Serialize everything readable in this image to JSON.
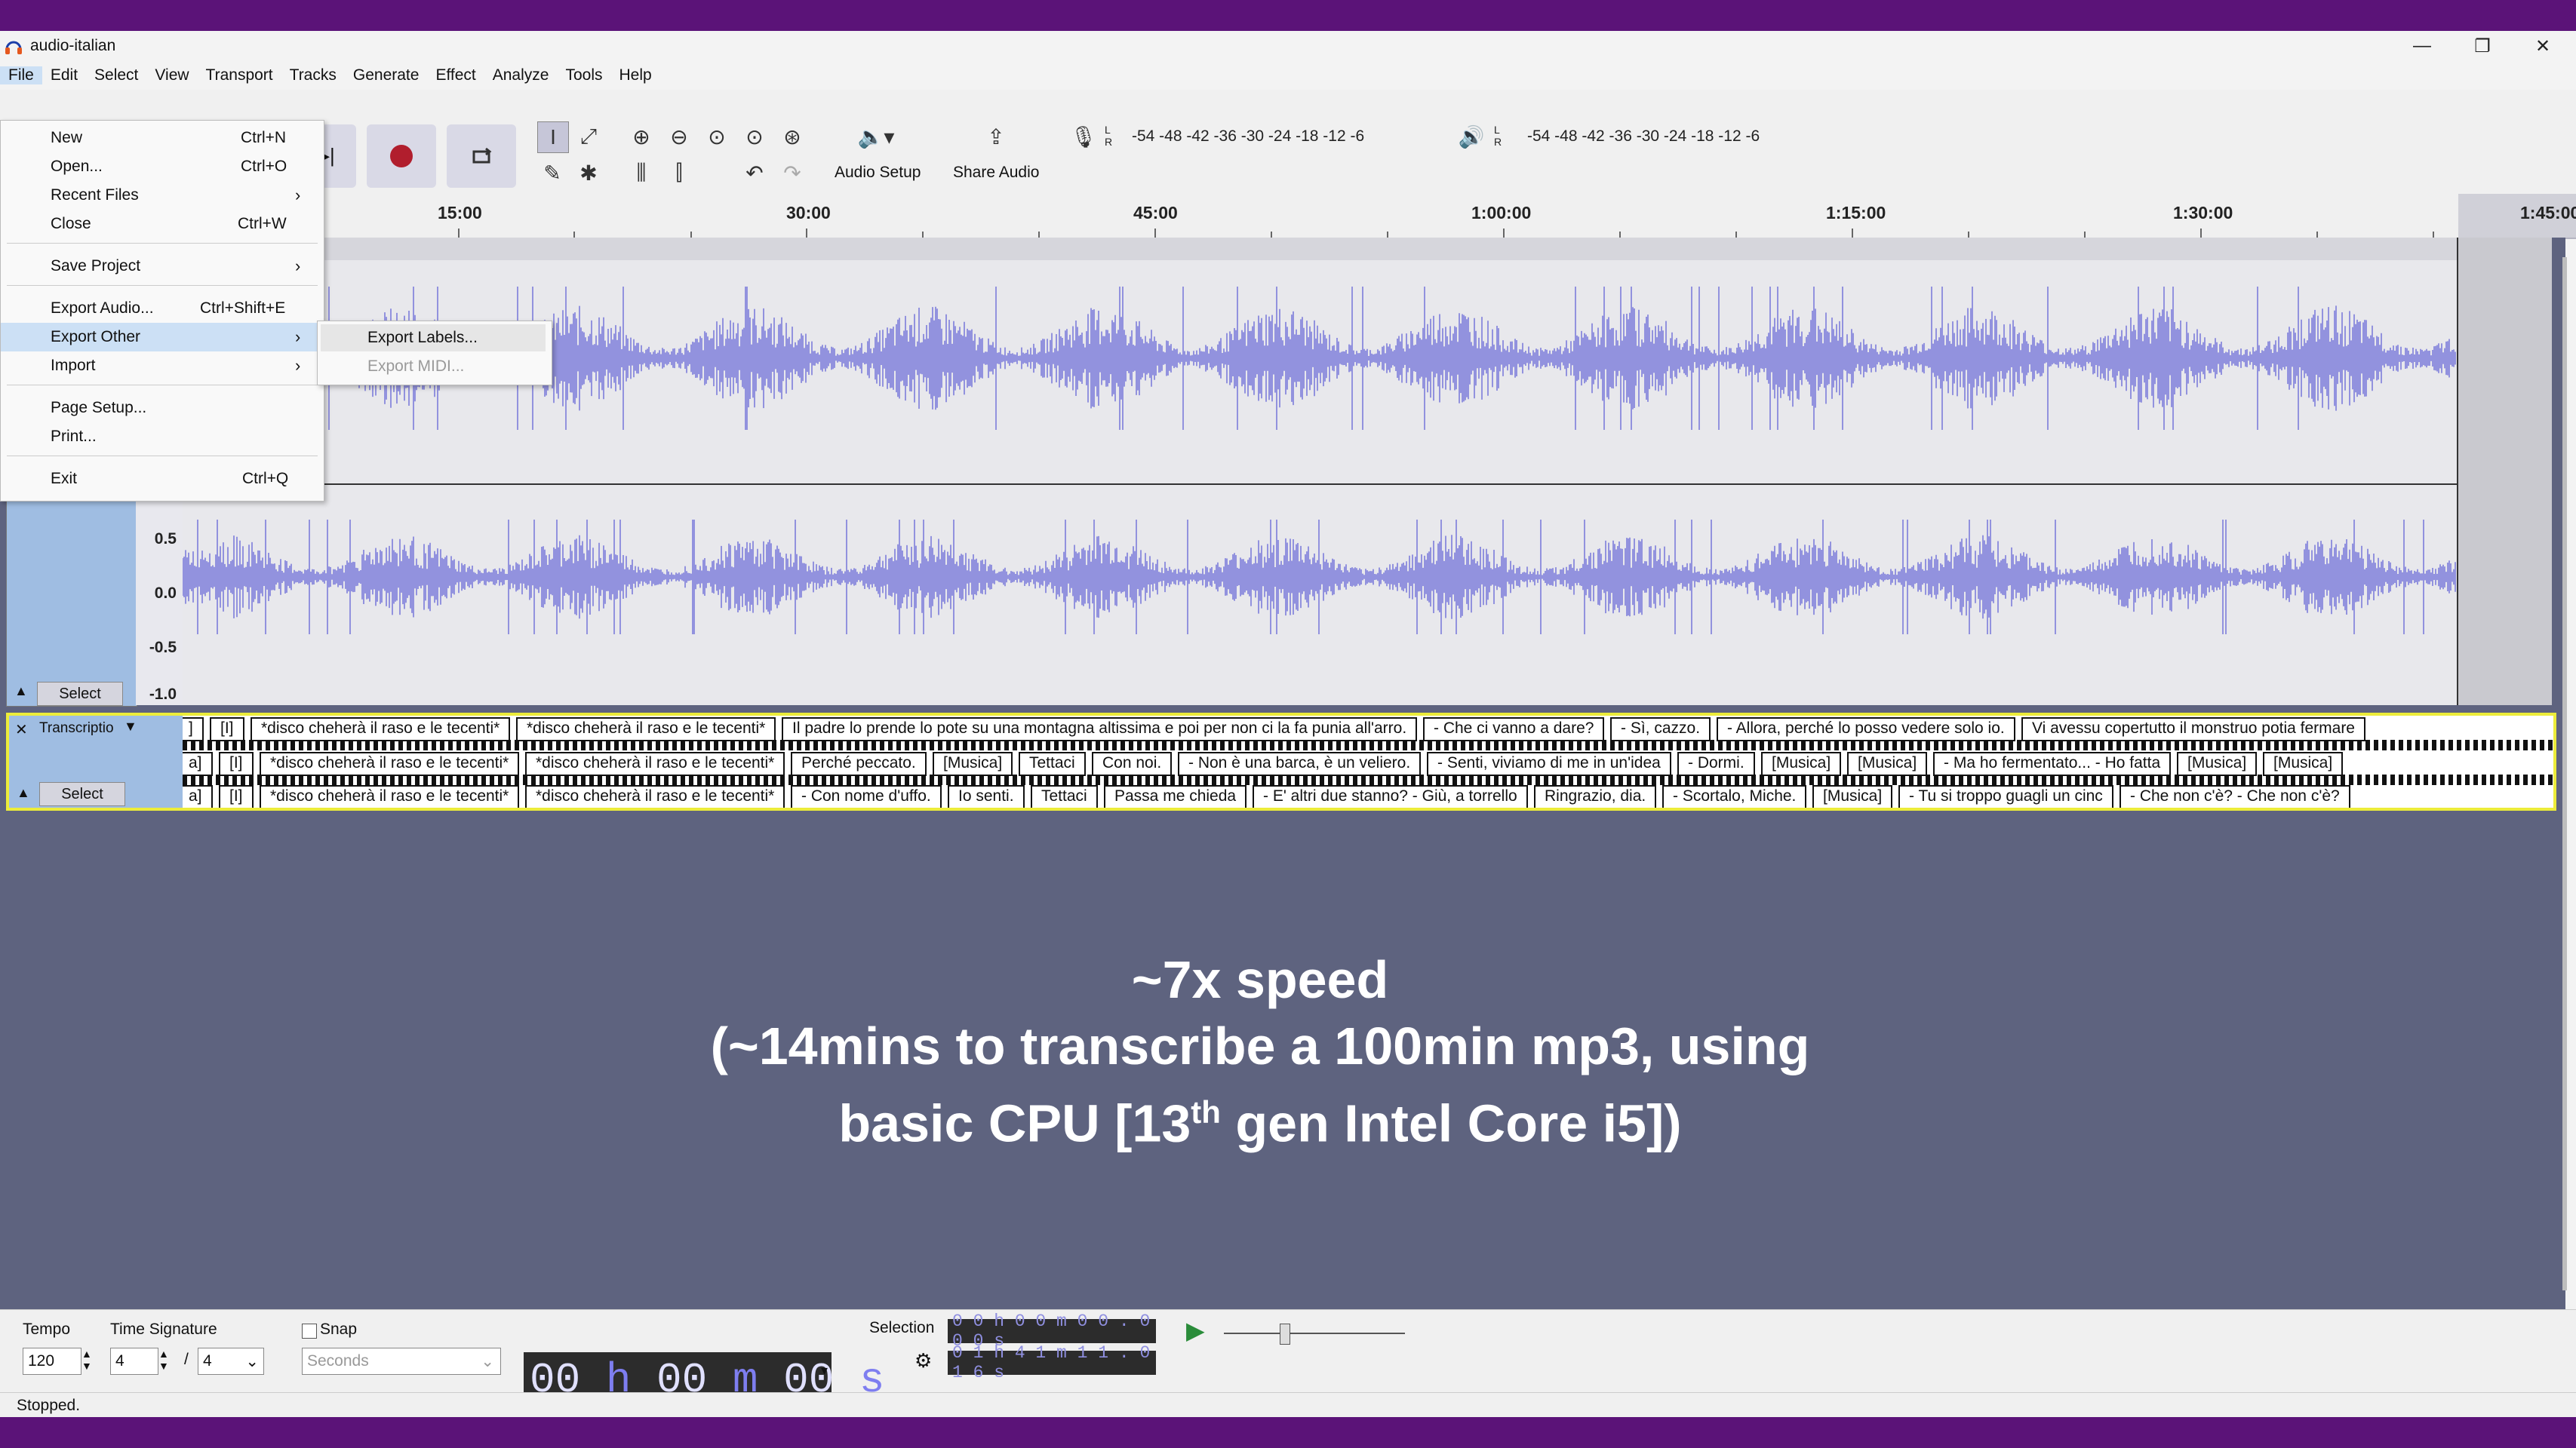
{
  "window": {
    "title": "audio-italian",
    "controls": [
      "—",
      "❐",
      "✕"
    ]
  },
  "menubar": [
    "File",
    "Edit",
    "Select",
    "View",
    "Transport",
    "Tracks",
    "Generate",
    "Effect",
    "Analyze",
    "Tools",
    "Help"
  ],
  "toolbar": {
    "audio_setup_label": "Audio Setup",
    "share_audio_label": "Share Audio",
    "record_meter_scale": "-54  -48  -42  -36  -30  -24  -18  -12  -6",
    "play_meter_scale": "-54  -48  -42  -36  -30  -24  -18  -12  -6",
    "meter_lr": "L\nR"
  },
  "ruler": {
    "labels": [
      "15:00",
      "30:00",
      "45:00",
      "1:00:00",
      "1:15:00",
      "1:30:00",
      "1:45:00"
    ]
  },
  "audio_track": {
    "scale": [
      "0.5",
      "0.0",
      "-0.5",
      "-1.0"
    ],
    "select_label": "Select",
    "wave_color": "#3d3dd0"
  },
  "label_track": {
    "name": "Transcriptio",
    "select_label": "Select",
    "row1": [
      "]",
      "[I]",
      "*disco cheherà il raso e le tecenti*",
      "*disco cheherà il raso e le tecenti*",
      "Il padre lo prende lo pote su una montagna altissima e poi per non ci la fa punia all'arro.",
      "- Che ci vanno a dare?",
      "- Sì, cazzo.",
      "- Allora, perché lo posso vedere solo io.",
      "Vi avessu copertutto il monstruo potia fermare"
    ],
    "row2": [
      "a]",
      "[I]",
      "*disco cheherà il raso e le tecenti*",
      "*disco cheherà il raso e le tecenti*",
      "Perché peccato.",
      "[Musica]",
      "Tettaci",
      "Con noi.",
      "- Non è una barca, è un veliero.",
      "- Senti, viviamo di me in un'idea",
      "- Dormi.",
      "[Musica]",
      "[Musica]",
      "- Ma ho fermentato... - Ho fatta",
      "[Musica]",
      "[Musica]"
    ],
    "row3": [
      "a]",
      "[I]",
      "*disco cheherà il raso e le tecenti*",
      "*disco cheherà il raso e le tecenti*",
      "- Con nome d'uffo.",
      "Io senti.",
      "Tettaci",
      "Passa me chieda",
      "- E' altri due stanno? - Giù, a torrello",
      "Ringrazio, dia.",
      "- Scortalo, Miche.",
      "[Musica]",
      "- Tu si troppo guagli un cinc",
      "- Che non c'è? - Che non c'è?"
    ]
  },
  "overlay": {
    "line1": "~7x speed",
    "line2": "(~14mins to transcribe a 100min mp3, using",
    "line3a": "basic CPU [13",
    "line3sup": "th",
    "line3b": " gen Intel Core i5])"
  },
  "file_menu": {
    "items": [
      {
        "label": "New",
        "shortcut": "Ctrl+N"
      },
      {
        "label": "Open...",
        "shortcut": "Ctrl+O"
      },
      {
        "label": "Recent Files",
        "shortcut": ""
      },
      {
        "label": "Close",
        "shortcut": "Ctrl+W"
      },
      {
        "label": "Save Project",
        "shortcut": ""
      },
      {
        "label": "Export Audio...",
        "shortcut": "Ctrl+Shift+E"
      },
      {
        "label": "Export Other",
        "shortcut": ""
      },
      {
        "label": "Import",
        "shortcut": ""
      },
      {
        "label": "Page Setup...",
        "shortcut": ""
      },
      {
        "label": "Print...",
        "shortcut": ""
      },
      {
        "label": "Exit",
        "shortcut": "Ctrl+Q"
      }
    ],
    "submenu": {
      "export_labels": "Export Labels...",
      "export_midi": "Export MIDI..."
    }
  },
  "bottom": {
    "tempo_label": "Tempo",
    "tempo_value": "120",
    "time_signature_label": "Time Signature",
    "ts_num": "4",
    "ts_sep": "/",
    "ts_den": "4",
    "snap_label": "Snap",
    "snap_unit": "Seconds",
    "time_h": "00",
    "time_m": "00",
    "time_s": "00",
    "time_h_unit": "h",
    "time_m_unit": "m",
    "time_s_unit": "s",
    "selection_label": "Selection",
    "sel_start": "0 0 h 0 0 m 0 0 . 0 0 0 s",
    "sel_end": "0 1 h 4 1 m 1 1 . 0 1 6 s"
  },
  "status": {
    "text": "Stopped."
  }
}
